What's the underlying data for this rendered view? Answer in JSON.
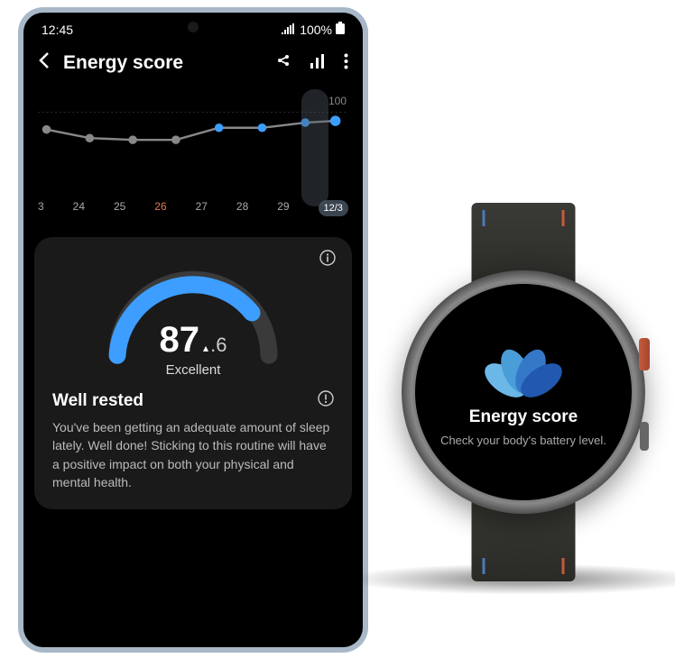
{
  "status": {
    "time": "12:45",
    "battery": "100%"
  },
  "header": {
    "title": "Energy score"
  },
  "chart_data": {
    "type": "line",
    "title": "Energy score",
    "ylim": [
      0,
      100
    ],
    "max_label": "100",
    "categories": [
      "3",
      "24",
      "25",
      "26",
      "27",
      "28",
      "29",
      "12/3"
    ],
    "values": [
      78,
      72,
      71,
      71,
      80,
      80,
      83,
      84
    ],
    "highlight_index": 3,
    "selected_index": 7
  },
  "gauge": {
    "value_main": "87",
    "value_decimal": ".6",
    "direction": "up",
    "label": "Excellent",
    "percent": 87
  },
  "summary": {
    "title": "Well rested",
    "body": "You've been getting an adequate amount of sleep lately. Well done! Sticking to this routine will have a positive impact on both your physical and mental health."
  },
  "watch": {
    "title": "Energy score",
    "subtitle": "Check your body's battery level."
  }
}
